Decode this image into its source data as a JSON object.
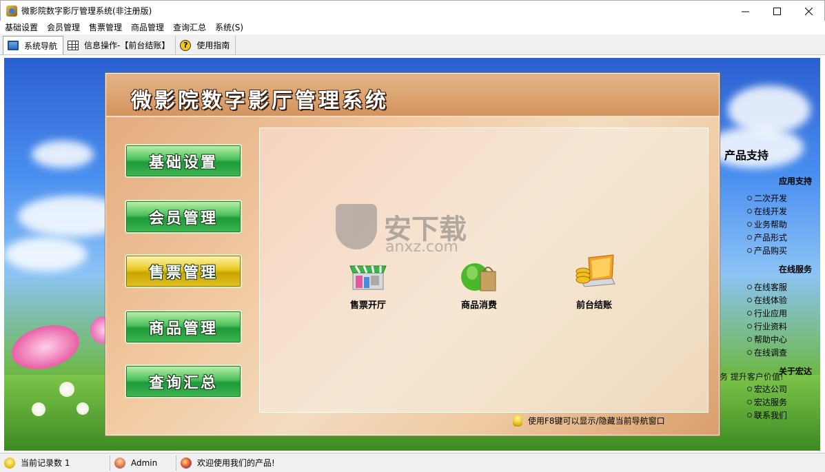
{
  "window": {
    "title": "微影院数字影厅管理系统(非注册版)"
  },
  "menu": {
    "items": [
      "基础设置",
      "会员管理",
      "售票管理",
      "商品管理",
      "查询汇总",
      "系统(S)"
    ]
  },
  "toolbar": {
    "tabs": [
      "系统导航",
      "信息操作-【前台结账】",
      "使用指南"
    ]
  },
  "panel": {
    "title": "微影院数字影厅管理系统",
    "nav_buttons": [
      "基础设置",
      "会员管理",
      "售票管理",
      "商品管理",
      "查询汇总"
    ],
    "selected_button": "售票管理",
    "functions": [
      "售票开厅",
      "商品消费",
      "前台结账"
    ],
    "hint": "使用F8键可以显示/隐藏当前导航窗口",
    "watermark": "安下载",
    "watermark_sub": "anxz.com"
  },
  "sidebar": {
    "title": "产品支持",
    "sections": [
      {
        "heading": "应用支持",
        "links": [
          "二次开发",
          "在线开发",
          "业务帮助",
          "产品形式",
          "产品购买"
        ]
      },
      {
        "heading": "在线服务",
        "links": [
          "在线客服",
          "在线体验",
          "行业应用",
          "行业资料",
          "帮助中心",
          "在线调查"
        ]
      },
      {
        "heading": "关于宏达",
        "links": [
          "宏达公司",
          "宏达服务",
          "联系我们"
        ]
      }
    ],
    "marquee": "宏达理念:诚信、创新、服务 提升客户价值!"
  },
  "statusbar": {
    "record_count": "当前记录数 1",
    "user": "Admin",
    "welcome": "欢迎使用我们的产品!"
  },
  "colors": {
    "nav_green": "#2fae48",
    "nav_selected": "#e0c020",
    "panel_orange": "#e2a77a"
  }
}
